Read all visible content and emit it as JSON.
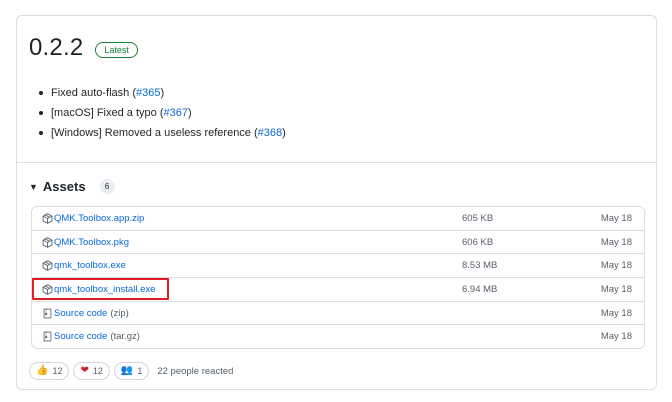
{
  "release": {
    "version": "0.2.2",
    "badge": "Latest",
    "notes": [
      {
        "text": "Fixed auto-flash (",
        "ref": "#365",
        "tail": ")"
      },
      {
        "text": "[macOS] Fixed a typo (",
        "ref": "#367",
        "tail": ")"
      },
      {
        "text": "[Windows] Removed a useless reference (",
        "ref": "#368",
        "tail": ")"
      }
    ]
  },
  "assets": {
    "title": "Assets",
    "count": "6",
    "rows": [
      {
        "icon": "package-icon",
        "name": "QMK.Toolbox.app.zip",
        "suffix": "",
        "size": "605 KB",
        "date": "May 18"
      },
      {
        "icon": "package-icon",
        "name": "QMK.Toolbox.pkg",
        "suffix": "",
        "size": "606 KB",
        "date": "May 18"
      },
      {
        "icon": "package-icon",
        "name": "qmk_toolbox.exe",
        "suffix": "",
        "size": "8.53 MB",
        "date": "May 18"
      },
      {
        "icon": "package-icon",
        "name": "qmk_toolbox_install.exe",
        "suffix": "",
        "size": "6.94 MB",
        "date": "May 18"
      },
      {
        "icon": "file-zip-icon",
        "name": "Source code",
        "suffix": "(zip)",
        "size": "",
        "date": "May 18"
      },
      {
        "icon": "file-zip-icon",
        "name": "Source code",
        "suffix": "(tar.gz)",
        "size": "",
        "date": "May 18"
      }
    ]
  },
  "reactions": {
    "items": [
      {
        "icon": "thumbs-up-icon",
        "emoji": "👍",
        "count": "12"
      },
      {
        "icon": "heart-icon",
        "emoji": "❤",
        "count": "12"
      },
      {
        "icon": "people-icon",
        "emoji": "👥",
        "count": "1"
      }
    ],
    "summary": "22 people reacted"
  },
  "colors": {
    "link": "#0969da",
    "badge": "#1a7f37",
    "highlight": "#e11b22"
  }
}
